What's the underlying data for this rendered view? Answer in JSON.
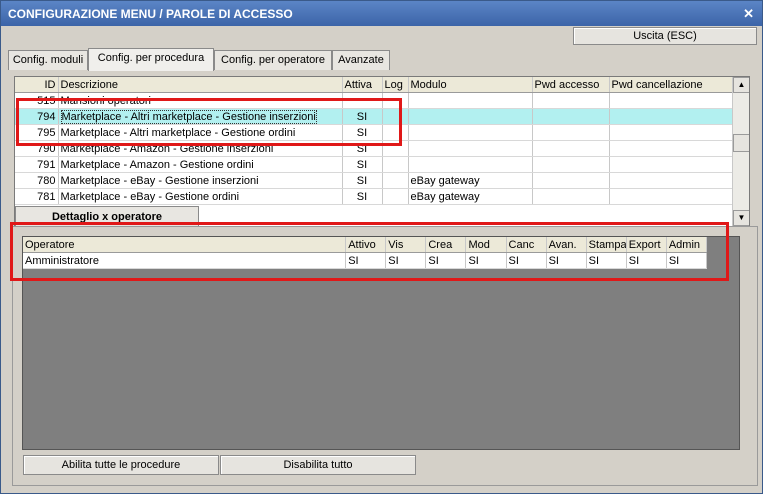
{
  "window": {
    "title": "CONFIGURAZIONE MENU / PAROLE DI ACCESSO",
    "close_glyph": "✕"
  },
  "exit_button": "Uscita (ESC)",
  "tabs": [
    {
      "label": "Config. moduli",
      "active": false
    },
    {
      "label": "Config. per procedura",
      "active": true
    },
    {
      "label": "Config. per operatore",
      "active": false
    },
    {
      "label": "Avanzate",
      "active": false
    }
  ],
  "procedures": {
    "columns": [
      "ID",
      "Descrizione",
      "Attiva",
      "Log",
      "Modulo",
      "Pwd accesso",
      "Pwd cancellazione"
    ],
    "rows": [
      {
        "id": "515",
        "desc": "Mansioni operatori",
        "attiva": "",
        "log": "",
        "modulo": "",
        "pwd": "",
        "pwdc": ""
      },
      {
        "id": "794",
        "desc": "Marketplace - Altri marketplace - Gestione inserzioni",
        "attiva": "SI",
        "log": "",
        "modulo": "",
        "pwd": "",
        "pwdc": "",
        "selected": true
      },
      {
        "id": "795",
        "desc": "Marketplace - Altri marketplace - Gestione ordini",
        "attiva": "SI",
        "log": "",
        "modulo": "",
        "pwd": "",
        "pwdc": ""
      },
      {
        "id": "790",
        "desc": "Marketplace - Amazon - Gestione inserzioni",
        "attiva": "SI",
        "log": "",
        "modulo": "",
        "pwd": "",
        "pwdc": ""
      },
      {
        "id": "791",
        "desc": "Marketplace - Amazon - Gestione ordini",
        "attiva": "SI",
        "log": "",
        "modulo": "",
        "pwd": "",
        "pwdc": ""
      },
      {
        "id": "780",
        "desc": "Marketplace - eBay - Gestione inserzioni",
        "attiva": "SI",
        "log": "",
        "modulo": "eBay gateway",
        "pwd": "",
        "pwdc": ""
      },
      {
        "id": "781",
        "desc": "Marketplace - eBay - Gestione ordini",
        "attiva": "SI",
        "log": "",
        "modulo": "eBay gateway",
        "pwd": "",
        "pwdc": ""
      }
    ],
    "scroll_up_glyph": "▲",
    "scroll_down_glyph": "▼"
  },
  "detail": {
    "tab_label": "Dettaglio x operatore",
    "columns": [
      "Operatore",
      "Attivo",
      "Vis",
      "Crea",
      "Mod",
      "Canc",
      "Avan.",
      "Stampa",
      "Export",
      "Admin"
    ],
    "rows": [
      {
        "values": [
          "Amministratore",
          "SI",
          "SI",
          "SI",
          "SI",
          "SI",
          "SI",
          "SI",
          "SI",
          "SI"
        ]
      }
    ]
  },
  "buttons": {
    "enable_all": "Abilita tutte le procedure",
    "disable_all": "Disabilita tutto"
  },
  "colors": {
    "highlight": "#e01818",
    "selection": "#b2f0f0",
    "titlebar": "#3c64a8"
  }
}
